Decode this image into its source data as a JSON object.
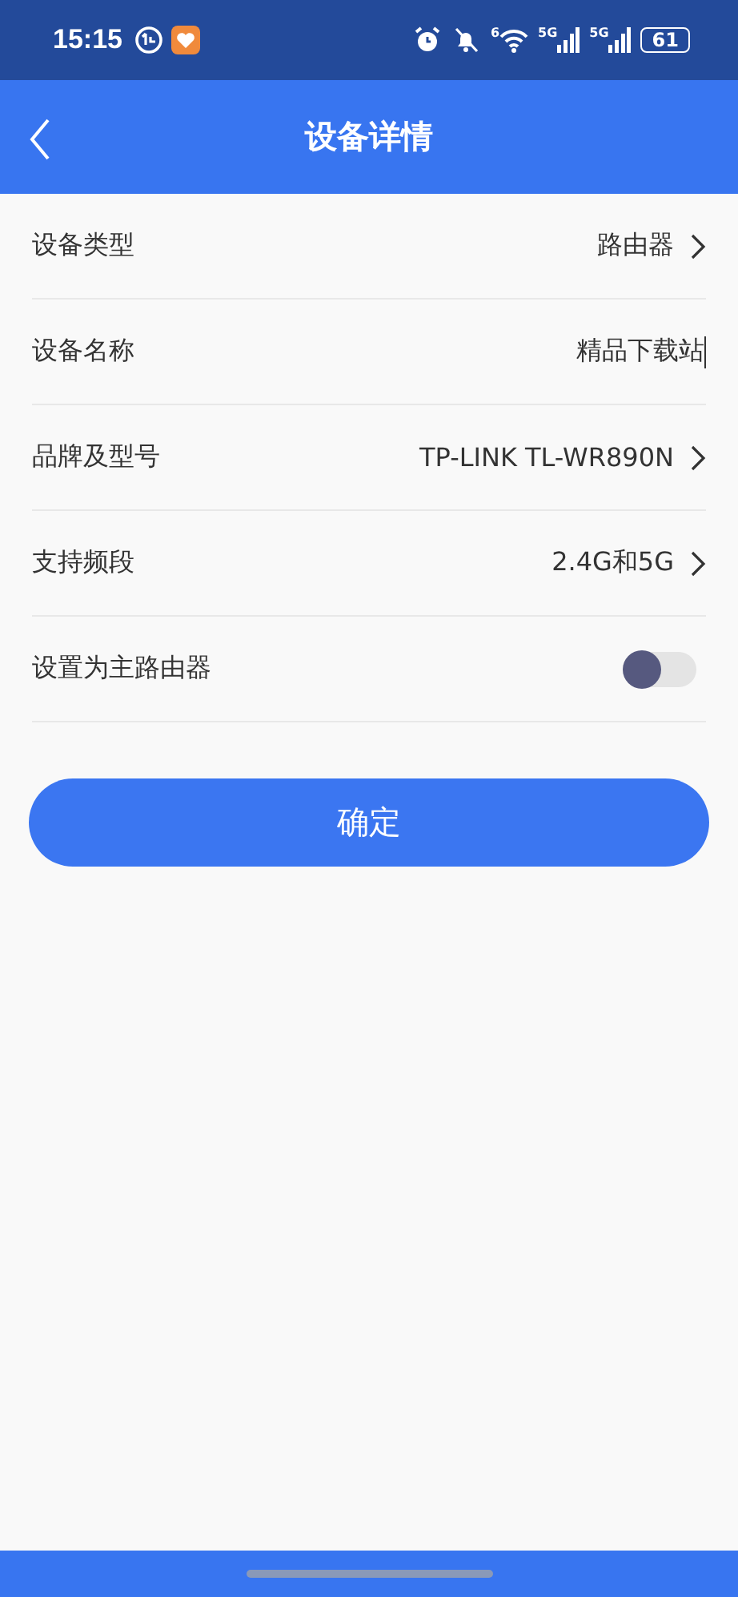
{
  "status_bar": {
    "time": "15:15",
    "wifi_label": "6",
    "signals": [
      {
        "label": "5G"
      },
      {
        "label": "5G"
      }
    ],
    "battery": "61"
  },
  "header": {
    "title": "设备详情"
  },
  "rows": [
    {
      "kind": "link",
      "label": "设备类型",
      "value": "路由器"
    },
    {
      "kind": "input",
      "label": "设备名称",
      "value": "精品下载站"
    },
    {
      "kind": "link",
      "label": "品牌及型号",
      "value": "TP-LINK TL-WR890N"
    },
    {
      "kind": "link",
      "label": "支持频段",
      "value": "2.4G和5G"
    },
    {
      "kind": "toggle",
      "label": "设置为主路由器",
      "on": false
    }
  ],
  "confirm_button": "确定"
}
